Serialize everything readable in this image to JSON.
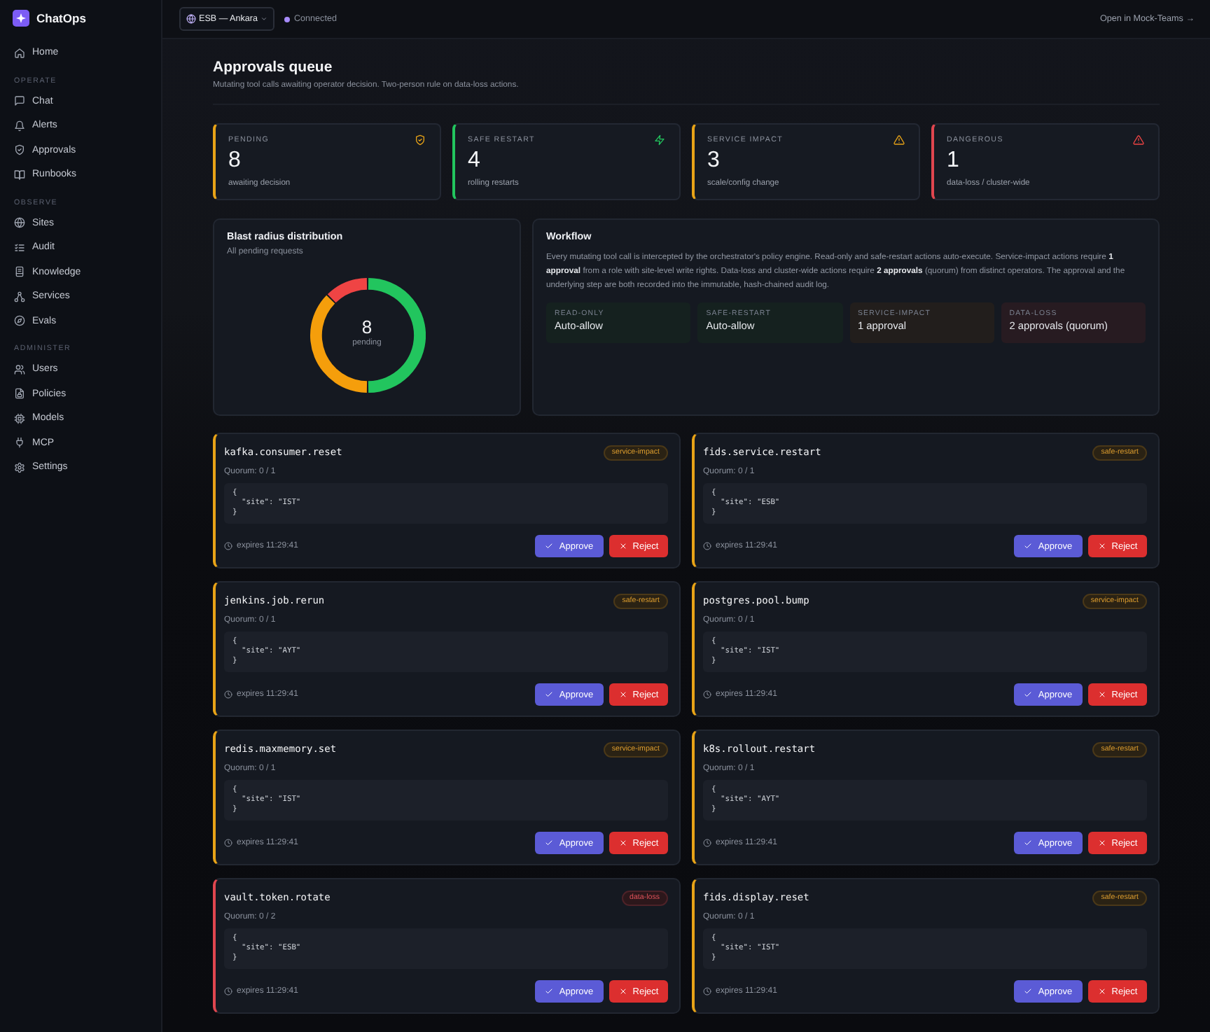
{
  "sidebar": {
    "brand": "ChatOps",
    "groups": [
      {
        "items": [
          {
            "label": "Home",
            "selected": false
          }
        ]
      },
      {
        "heading": "OPERATE",
        "items": [
          {
            "label": "Chat",
            "selected": false
          },
          {
            "label": "Alerts",
            "selected": false
          },
          {
            "label": "Approvals",
            "selected": false
          },
          {
            "label": "Runbooks",
            "selected": false
          }
        ]
      },
      {
        "heading": "OBSERVE",
        "items": [
          {
            "label": "Sites",
            "selected": false
          },
          {
            "label": "Audit",
            "selected": false
          },
          {
            "label": "Knowledge",
            "selected": false
          },
          {
            "label": "Services",
            "selected": false
          },
          {
            "label": "Evals",
            "selected": false
          }
        ]
      },
      {
        "heading": "ADMINISTER",
        "items": [
          {
            "label": "Users",
            "selected": false
          },
          {
            "label": "Policies",
            "selected": false
          },
          {
            "label": "Models",
            "selected": false
          },
          {
            "label": "MCP",
            "selected": false
          },
          {
            "label": "Settings",
            "selected": false
          }
        ]
      }
    ]
  },
  "topbar": {
    "site": "ESB — Ankara",
    "status": {
      "label": "Connected",
      "connected": true
    },
    "link": "Open in Mock-Teams →"
  },
  "header": {
    "title": "Approvals queue",
    "subtitle": "Mutating tool calls awaiting operator decision. Two-person rule on data-loss actions."
  },
  "stats": [
    {
      "kind": "pending",
      "label": "PENDING",
      "value": "8",
      "caption": "awaiting decision"
    },
    {
      "kind": "safe",
      "label": "SAFE RESTART",
      "value": "4",
      "caption": "rolling restarts"
    },
    {
      "kind": "impact",
      "label": "SERVICE IMPACT",
      "value": "3",
      "caption": "scale/config change"
    },
    {
      "kind": "danger",
      "label": "DANGEROUS",
      "value": "1",
      "caption": "data-loss / cluster-wide"
    }
  ],
  "distribution": {
    "title": "Blast radius distribution",
    "subtitle": "All pending requests",
    "center_value": "8",
    "center_label": "pending"
  },
  "workflow": {
    "title": "Workflow",
    "text": "Every mutating tool call is intercepted by the orchestrator's policy engine. Read-only and safe-restart actions auto-execute. Service-impact actions require **1 approval** from a role with site-level write rights. Data-loss and cluster-wide actions require **2 approvals** (quorum) from distinct operators. The approval and the underlying step are both recorded into the immutable, hash-chained audit log.",
    "tiers": [
      {
        "kind": "safe",
        "label": "READ-ONLY",
        "value": "Auto-allow"
      },
      {
        "kind": "safe",
        "label": "SAFE-RESTART",
        "value": "Auto-allow"
      },
      {
        "kind": "impact",
        "label": "SERVICE-IMPACT",
        "value": "1 approval"
      },
      {
        "kind": "danger",
        "label": "DATA-LOSS",
        "value": "2 approvals (quorum)"
      }
    ]
  },
  "requests": [
    {
      "kind": "warn",
      "name": "kafka.consumer.reset",
      "badge": "service-impact",
      "quorum": "Quorum: 0 / 1",
      "args": "{\n  \"site\": \"IST\"\n}",
      "expires": "expires 11:29:41",
      "approve": "Approve",
      "reject": "Reject"
    },
    {
      "kind": "warn",
      "name": "fids.service.restart",
      "badge": "safe-restart",
      "quorum": "Quorum: 0 / 1",
      "args": "{\n  \"site\": \"ESB\"\n}",
      "expires": "expires 11:29:41",
      "approve": "Approve",
      "reject": "Reject"
    },
    {
      "kind": "warn",
      "name": "jenkins.job.rerun",
      "badge": "safe-restart",
      "quorum": "Quorum: 0 / 1",
      "args": "{\n  \"site\": \"AYT\"\n}",
      "expires": "expires 11:29:41",
      "approve": "Approve",
      "reject": "Reject"
    },
    {
      "kind": "warn",
      "name": "postgres.pool.bump",
      "badge": "service-impact",
      "quorum": "Quorum: 0 / 1",
      "args": "{\n  \"site\": \"IST\"\n}",
      "expires": "expires 11:29:41",
      "approve": "Approve",
      "reject": "Reject"
    },
    {
      "kind": "warn",
      "name": "redis.maxmemory.set",
      "badge": "service-impact",
      "quorum": "Quorum: 0 / 1",
      "args": "{\n  \"site\": \"IST\"\n}",
      "expires": "expires 11:29:41",
      "approve": "Approve",
      "reject": "Reject"
    },
    {
      "kind": "warn",
      "name": "k8s.rollout.restart",
      "badge": "safe-restart",
      "quorum": "Quorum: 0 / 1",
      "args": "{\n  \"site\": \"AYT\"\n}",
      "expires": "expires 11:29:41",
      "approve": "Approve",
      "reject": "Reject"
    },
    {
      "kind": "danger",
      "name": "vault.token.rotate",
      "badge": "data-loss",
      "quorum": "Quorum: 0 / 2",
      "args": "{\n  \"site\": \"ESB\"\n}",
      "expires": "expires 11:29:41",
      "approve": "Approve",
      "reject": "Reject"
    },
    {
      "kind": "warn",
      "name": "fids.display.reset",
      "badge": "safe-restart",
      "quorum": "Quorum: 0 / 1",
      "args": "{\n  \"site\": \"IST\"\n}",
      "expires": "expires 11:29:41",
      "approve": "Approve",
      "reject": "Reject"
    }
  ]
}
